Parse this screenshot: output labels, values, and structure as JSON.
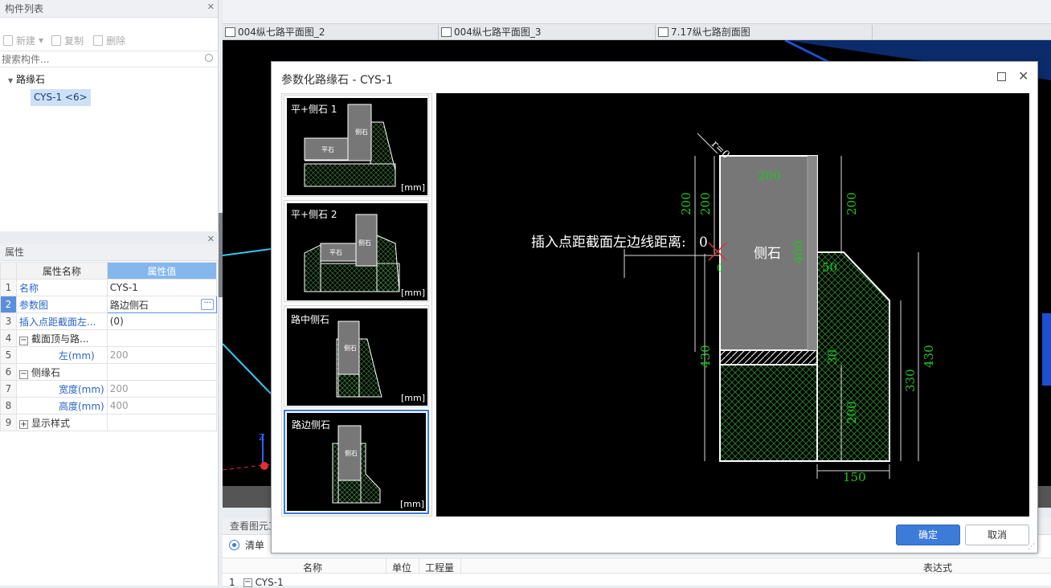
{
  "left_panel": {
    "title": "构件列表",
    "toolbar": {
      "new": "新建",
      "copy": "复制",
      "delete": "删除"
    },
    "search_placeholder": "搜索构件...",
    "tree": {
      "category": "路缘石",
      "item": "CYS-1 <6>"
    }
  },
  "properties": {
    "title": "属性",
    "col_name": "属性名称",
    "col_value": "属性值",
    "rows": [
      {
        "n": "1",
        "name": "名称",
        "value": "CYS-1"
      },
      {
        "n": "2",
        "name": "参数图",
        "value": "路边侧石"
      },
      {
        "n": "3",
        "name": "插入点距截面左...",
        "value": "(0)"
      },
      {
        "n": "4",
        "name": "截面顶与路...",
        "value": ""
      },
      {
        "n": "5",
        "name": "左(mm)",
        "value": "200"
      },
      {
        "n": "6",
        "name": "侧缘石",
        "value": ""
      },
      {
        "n": "7",
        "name": "宽度(mm)",
        "value": "200"
      },
      {
        "n": "8",
        "name": "高度(mm)",
        "value": "400"
      },
      {
        "n": "9",
        "name": "显示样式",
        "value": ""
      }
    ],
    "expand_symbol": "−",
    "collapse_symbol": "+",
    "more_symbol": "···"
  },
  "tabs": [
    "004纵七路平面图_2",
    "004纵七路平面图_3",
    "7.17纵七路剖面图"
  ],
  "bottom_panel": {
    "title": "查看图元工",
    "radio_label": "清单",
    "cols": [
      "名称",
      "单位",
      "工程量",
      "表达式"
    ],
    "row1": {
      "n": "1",
      "name": "CYS-1"
    }
  },
  "dialog": {
    "title": "参数化路缘石 - CYS-1",
    "thumbs": [
      {
        "label": "平+侧石 1",
        "flat": "平石",
        "side": "侧石"
      },
      {
        "label": "平+侧石 2",
        "flat": "平石",
        "side": "侧石"
      },
      {
        "label": "路中侧石",
        "side": "侧石"
      },
      {
        "label": "路边侧石",
        "side": "侧石"
      }
    ],
    "unit": "[mm]",
    "drawing": {
      "insert_label": "插入点距截面左边线距离:",
      "insert_value": "0",
      "radius": "r=0",
      "stone_label": "侧石",
      "dims": {
        "top_width": "200",
        "left_top": "200",
        "left_top2": "200",
        "right_top": "200",
        "stone_height": "400",
        "slope_width": "50",
        "left_total": "430",
        "right_total": "430",
        "mid_330": "330",
        "gap_30": "30",
        "base_200": "200",
        "bottom_150": "150",
        "origin": "0"
      }
    },
    "ok": "确定",
    "cancel": "取消"
  },
  "colors": {
    "accent": "#3c7bd8",
    "dim_green": "#22c322",
    "canvas": "#000000"
  }
}
